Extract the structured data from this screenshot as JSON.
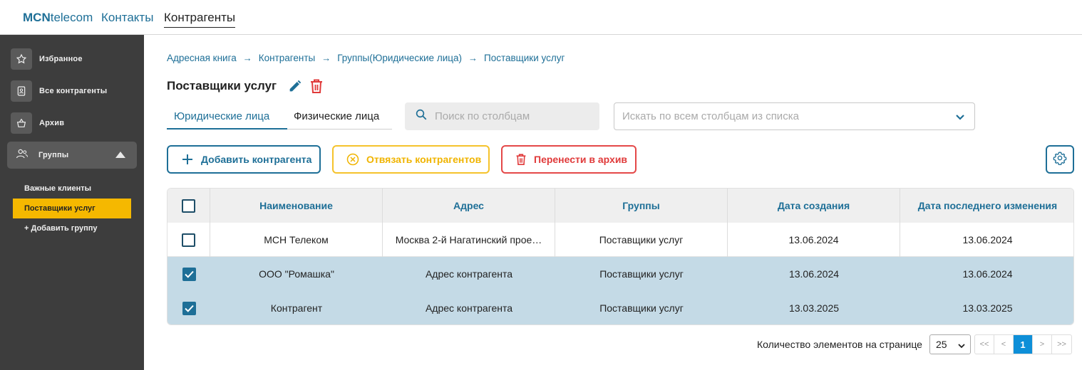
{
  "topbar": {
    "logo_bold": "MCN",
    "logo_rest": "telecom",
    "nav": [
      "Контакты",
      "Контрагенты"
    ]
  },
  "sidebar": {
    "items": [
      {
        "label": "Избранное",
        "icon": "star-icon"
      },
      {
        "label": "Все контрагенты",
        "icon": "contact-card-icon"
      },
      {
        "label": "Архив",
        "icon": "basket-icon"
      }
    ],
    "group": {
      "label": "Группы",
      "icon": "users-icon"
    },
    "subitems": [
      "Важные клиенты",
      "Поставщики услуг",
      "+ Добавить группу"
    ],
    "active_subitem": "Поставщики услуг",
    "accent_color": "#f5b800"
  },
  "breadcrumb": [
    "Адресная книга",
    "Контрагенты",
    "Группы(Юридические лица)",
    "Поставщики услуг"
  ],
  "page_title": "Поставщики услуг",
  "tabs": [
    "Юридические лица",
    "Физические лица"
  ],
  "active_tab": "Юридические лица",
  "search": {
    "placeholder": "Поиск по столбцам"
  },
  "column_select": {
    "placeholder": "Искать по всем столбцам из списка"
  },
  "buttons": {
    "add": "Добавить контрагента",
    "unlink": "Отвязать контрагентов",
    "archive": "Перенести в архив"
  },
  "table": {
    "headers": [
      "Наименование",
      "Адрес",
      "Группы",
      "Дата создания",
      "Дата последнего изменения"
    ],
    "rows": [
      {
        "checked": false,
        "cells": [
          "МСН Телеком",
          "Москва 2-й Нагатинский прое…",
          "Поставщики услуг",
          "13.06.2024",
          "13.06.2024"
        ]
      },
      {
        "checked": true,
        "cells": [
          "ООО \"Ромашка\"",
          "Адрес контрагента",
          "Поставщики услуг",
          "13.06.2024",
          "13.06.2024"
        ]
      },
      {
        "checked": true,
        "cells": [
          "Контрагент",
          "Адрес контрагента",
          "Поставщики услуг",
          "13.03.2025",
          "13.03.2025"
        ]
      }
    ]
  },
  "pagination": {
    "per_page_label": "Количество элементов на странице",
    "per_page": "25",
    "first": "<<",
    "prev": "<",
    "current": "1",
    "next": ">",
    "last": ">>"
  },
  "colors": {
    "primary": "#1e6f97",
    "warning": "#f5c32c",
    "danger": "#e44848",
    "selected_row": "#c4dae6"
  }
}
